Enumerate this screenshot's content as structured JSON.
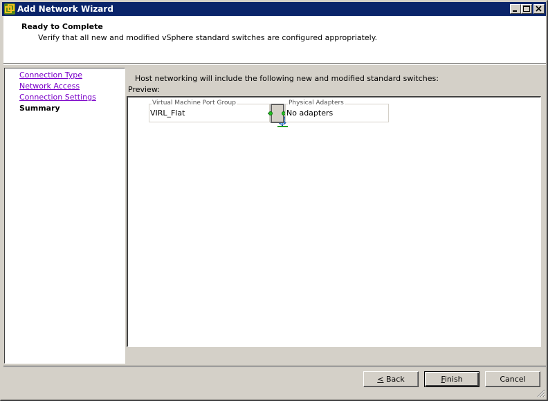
{
  "window": {
    "title": "Add Network Wizard",
    "controls": {
      "minimize": "minimize",
      "maximize": "maximize",
      "close": "close"
    }
  },
  "header": {
    "title": "Ready to Complete",
    "subtitle": "Verify that all new and modified vSphere standard switches are configured appropriately."
  },
  "nav": {
    "items": [
      {
        "label": "Connection Type",
        "state": "visited"
      },
      {
        "label": "Network Access",
        "state": "visited"
      },
      {
        "label": "Connection Settings",
        "state": "visited"
      },
      {
        "label": "Summary",
        "state": "current"
      }
    ]
  },
  "main": {
    "description": "Host networking will include the following new and modified standard switches:",
    "preview_label": "Preview:",
    "port_group": {
      "legend": "Virtual Machine Port Group",
      "name": "VIRL_Flat",
      "icon": "network-globe-icon"
    },
    "physical_adapters": {
      "legend": "Physical Adapters",
      "value": "No adapters"
    }
  },
  "buttons": {
    "back": {
      "mnemonic": "<",
      "rest": " Back"
    },
    "finish": {
      "mnemonic": "F",
      "rest": "inish"
    },
    "cancel": {
      "label": "Cancel"
    }
  },
  "colors": {
    "titlebar": "#0a246a",
    "visited_link": "#7a00c8",
    "dialog_bg": "#d4d0c8",
    "connector_dot": "#22c022"
  }
}
